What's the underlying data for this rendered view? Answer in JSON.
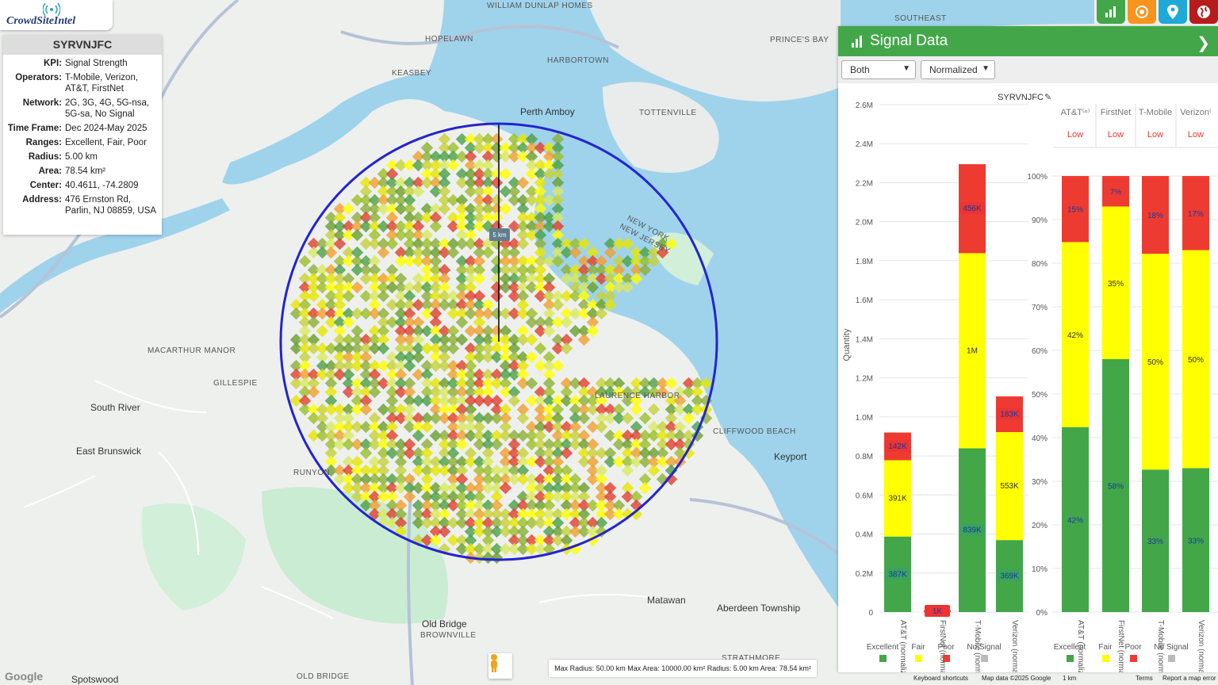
{
  "app": {
    "logo_text": "CrowdSiteIntel"
  },
  "info": {
    "title": "SYRVNJFC",
    "rows": [
      {
        "k": "KPI:",
        "v": "Signal Strength"
      },
      {
        "k": "Operators:",
        "v": "T-Mobile, Verizon, AT&T, FirstNet"
      },
      {
        "k": "Network:",
        "v": "2G, 3G, 4G, 5G-nsa, 5G-sa, No Signal"
      },
      {
        "k": "Time Frame:",
        "v": "Dec 2024-May 2025"
      },
      {
        "k": "Ranges:",
        "v": "Excellent, Fair, Poor"
      },
      {
        "k": "Radius:",
        "v": "5.00 km"
      },
      {
        "k": "Area:",
        "v": "78.54 km²"
      },
      {
        "k": "Center:",
        "v": "40.4611, -74.2809"
      },
      {
        "k": "Address:",
        "v": "476 Ernston Rd, Parlin, NJ 08859, USA"
      }
    ]
  },
  "map": {
    "radius_label": "5 km",
    "labels": [
      "WILLIAM DUNLAP HOMES",
      "HOPELAWN",
      "KEASBEY",
      "HARBORTOWN",
      "Perth Amboy",
      "TOTTENVILLE",
      "PRINCE'S BAY",
      "SOUTHEAST",
      "NEW YORK",
      "NEW JERSEY",
      "MACARTHUR MANOR",
      "GILLESPIE",
      "South River",
      "East Brunswick",
      "RUNYON",
      "CLIFFWOOD BEACH",
      "Keyport",
      "Matawan",
      "Aberdeen Township",
      "Old Bridge",
      "BROWNVILLE",
      "OLD BRIDGE",
      "Spotswood",
      "STRATHMORE",
      "LAURENCE HARBOR"
    ],
    "bottom_info": "Max Radius: 50.00 km Max Area: 10000.00 km² Radius: 5.00 km Area: 78.54 km²",
    "google": "Google",
    "attribution": [
      "Keyboard shortcuts",
      "Map data ©2025 Google",
      "1 km",
      "Terms",
      "Report a map error"
    ]
  },
  "panel": {
    "title": "Signal Data",
    "select_mode": "Both",
    "select_norm": "Normalized"
  },
  "colors": {
    "excellent": "#43a74a",
    "fair": "#ffff00",
    "poor": "#ee3b32",
    "nosignal": "#bbbbbb",
    "panel_green": "#43a74a",
    "circle": "#2424d0"
  },
  "chart_data": [
    {
      "type": "bar",
      "stacked": true,
      "title": "SYRVNJFC",
      "ylabel": "Quantity",
      "ylim": [
        0,
        2600000
      ],
      "yticks": [
        "0",
        "0.2M",
        "0.4M",
        "0.6M",
        "0.8M",
        "1.0M",
        "1.2M",
        "1.4M",
        "1.6M",
        "1.8M",
        "2.0M",
        "2.2M",
        "2.4M",
        "2.6M"
      ],
      "categories": [
        "AT&T (normalized)",
        "FirstNet (normalized)",
        "T-Mobile (normalized)",
        "Verizon (normalized)"
      ],
      "series": [
        {
          "name": "Excellent",
          "values": [
            387000,
            0,
            839000,
            369000
          ],
          "labels": [
            "387K",
            "",
            "839K",
            "369K"
          ]
        },
        {
          "name": "Fair",
          "values": [
            391000,
            0,
            1000000,
            553000
          ],
          "labels": [
            "391K",
            "",
            "1M",
            "553K"
          ]
        },
        {
          "name": "Poor",
          "values": [
            142000,
            1000,
            456000,
            183000
          ],
          "labels": [
            "142K",
            "1K",
            "456K",
            "183K"
          ]
        },
        {
          "name": "No Signal",
          "values": [
            0,
            0,
            0,
            0
          ],
          "labels": [
            "",
            "",
            "",
            ""
          ]
        }
      ]
    },
    {
      "type": "bar",
      "stacked": true,
      "percent": true,
      "ylim": [
        0,
        100
      ],
      "yticks": [
        "0%",
        "10%",
        "20%",
        "30%",
        "40%",
        "50%",
        "60%",
        "70%",
        "80%",
        "90%",
        "100%"
      ],
      "table_headers": [
        "AT&T⁽ⁿ⁾",
        "FirstNet",
        "T-Mobile",
        "Verizon⁽"
      ],
      "table_values": [
        "Low",
        "Low",
        "Low",
        "Low"
      ],
      "categories": [
        "AT&T (normalized)",
        "FirstNet (normalized)",
        "T-Mobile (normalized)",
        "Verizon (normalized)"
      ],
      "series": [
        {
          "name": "Excellent",
          "values": [
            42,
            58,
            33,
            33
          ],
          "labels": [
            "42%",
            "58%",
            "33%",
            "33%"
          ]
        },
        {
          "name": "Fair",
          "values": [
            42,
            35,
            50,
            50
          ],
          "labels": [
            "42%",
            "35%",
            "50%",
            "50%"
          ]
        },
        {
          "name": "Poor",
          "values": [
            15,
            7,
            18,
            17
          ],
          "labels": [
            "15%",
            "7%",
            "18%",
            "17%"
          ]
        },
        {
          "name": "No Signal",
          "values": [
            0,
            0,
            0,
            0
          ],
          "labels": [
            "",
            "",
            "",
            ""
          ]
        }
      ]
    }
  ]
}
